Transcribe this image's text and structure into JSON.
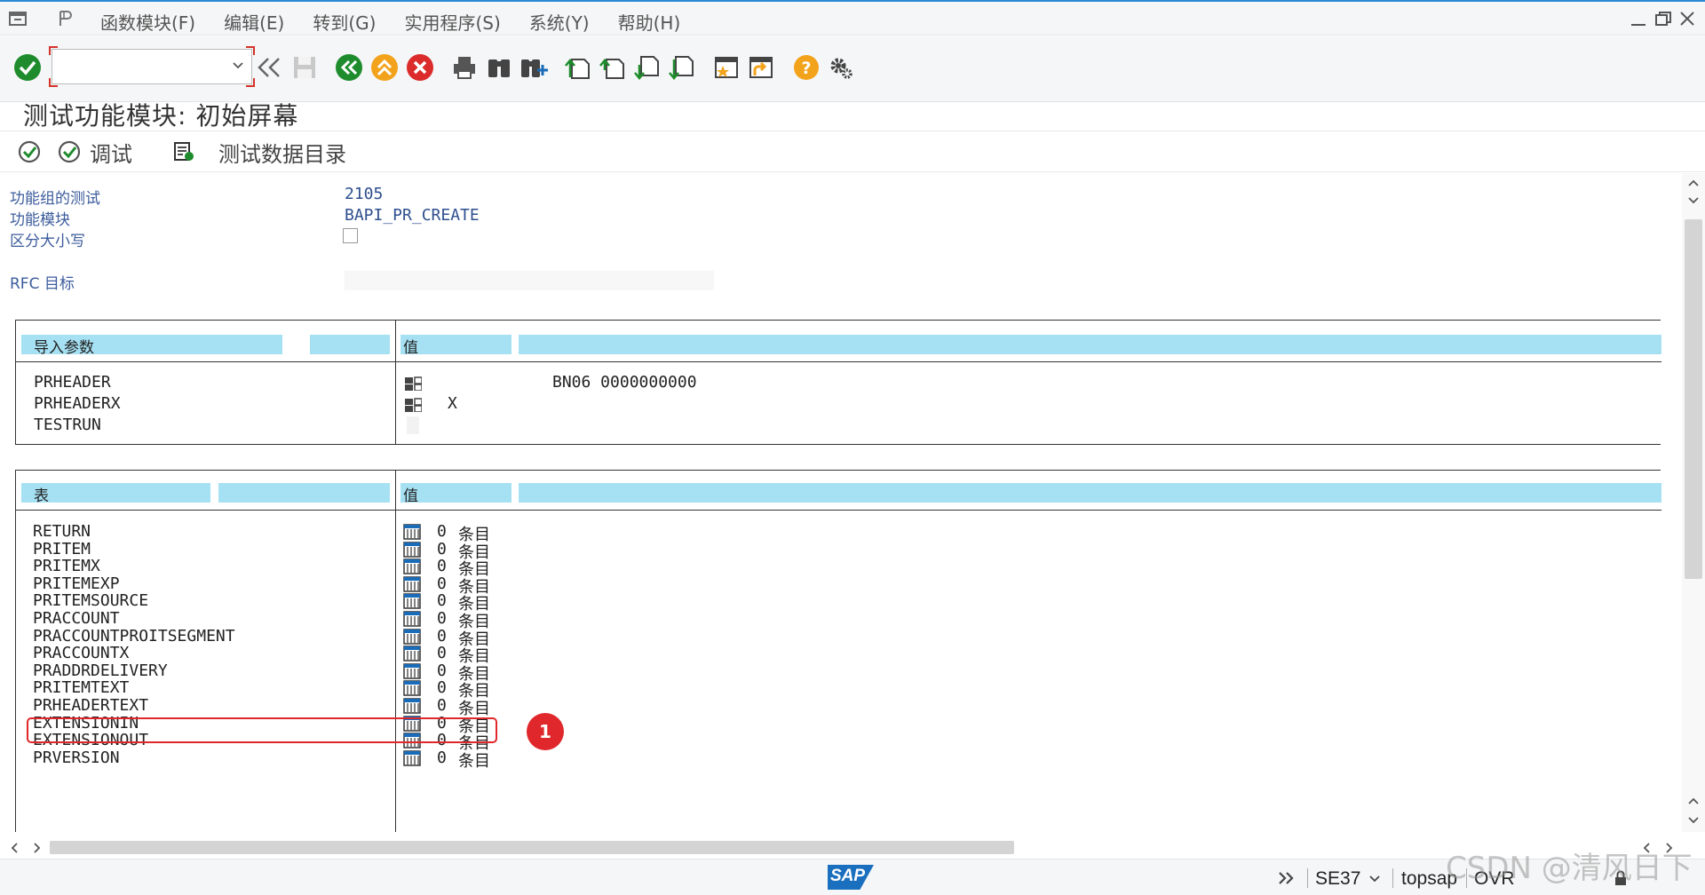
{
  "menu": {
    "items": [
      "函数模块(F)",
      "编辑(E)",
      "转到(G)",
      "实用程序(S)",
      "系统(Y)",
      "帮助(H)"
    ]
  },
  "toolbar": {
    "command_value": "",
    "icons": [
      "enter-icon",
      "command-field",
      "collapse-icon",
      "save-icon",
      "back-icon",
      "exit-icon",
      "cancel-icon",
      "print-icon",
      "find-icon",
      "find-next-icon",
      "first-page-icon",
      "prev-page-icon",
      "next-page-icon",
      "last-page-icon",
      "new-session-icon",
      "shortcut-icon",
      "help-icon",
      "settings-icon"
    ]
  },
  "title": "测试功能模块: 初始屏幕",
  "app_toolbar": {
    "execute_label": "",
    "debug_label": "调试",
    "test_data_label": "测试数据目录"
  },
  "header_fields": {
    "function_group_label": "功能组的测试",
    "function_group_value": "2105",
    "function_module_label": "功能模块",
    "function_module_value": "BAPI_PR_CREATE",
    "case_sensitive_label": "区分大小写",
    "rfc_target_label": "RFC 目标",
    "rfc_target_value": ""
  },
  "import_panel": {
    "header_name": "导入参数",
    "header_value": "值",
    "rows": [
      {
        "name": "PRHEADER",
        "icon": "structure-icon",
        "extra": "BN06    0000000000"
      },
      {
        "name": "PRHEADERX",
        "icon": "structure-icon",
        "extra": "X"
      },
      {
        "name": "TESTRUN",
        "icon": "",
        "extra": ""
      }
    ]
  },
  "tables_panel": {
    "header_name": "表",
    "header_value": "值",
    "unit": "条目",
    "rows": [
      {
        "name": "RETURN",
        "count": "0"
      },
      {
        "name": "PRITEM",
        "count": "0"
      },
      {
        "name": "PRITEMX",
        "count": "0"
      },
      {
        "name": "PRITEMEXP",
        "count": "0"
      },
      {
        "name": "PRITEMSOURCE",
        "count": "0"
      },
      {
        "name": "PRACCOUNT",
        "count": "0"
      },
      {
        "name": "PRACCOUNTPROITSEGMENT",
        "count": "0"
      },
      {
        "name": "PRACCOUNTX",
        "count": "0"
      },
      {
        "name": "PRADDRDELIVERY",
        "count": "0"
      },
      {
        "name": "PRITEMTEXT",
        "count": "0"
      },
      {
        "name": "PRHEADERTEXT",
        "count": "0"
      },
      {
        "name": "EXTENSIONIN",
        "count": "0"
      },
      {
        "name": "EXTENSIONOUT",
        "count": "0"
      },
      {
        "name": "PRVERSION",
        "count": "0"
      }
    ]
  },
  "annotation": {
    "marker": "1"
  },
  "status": {
    "transaction": "SE37",
    "server": "topsap",
    "mode": "OVR",
    "logo": "SAP"
  },
  "watermark": "CSDN @清风日下",
  "colors": {
    "header_bg": "#a6e1f3",
    "accent": "#2a8ad4",
    "highlight": "#e0282c",
    "field_label": "#3c5c9c"
  }
}
